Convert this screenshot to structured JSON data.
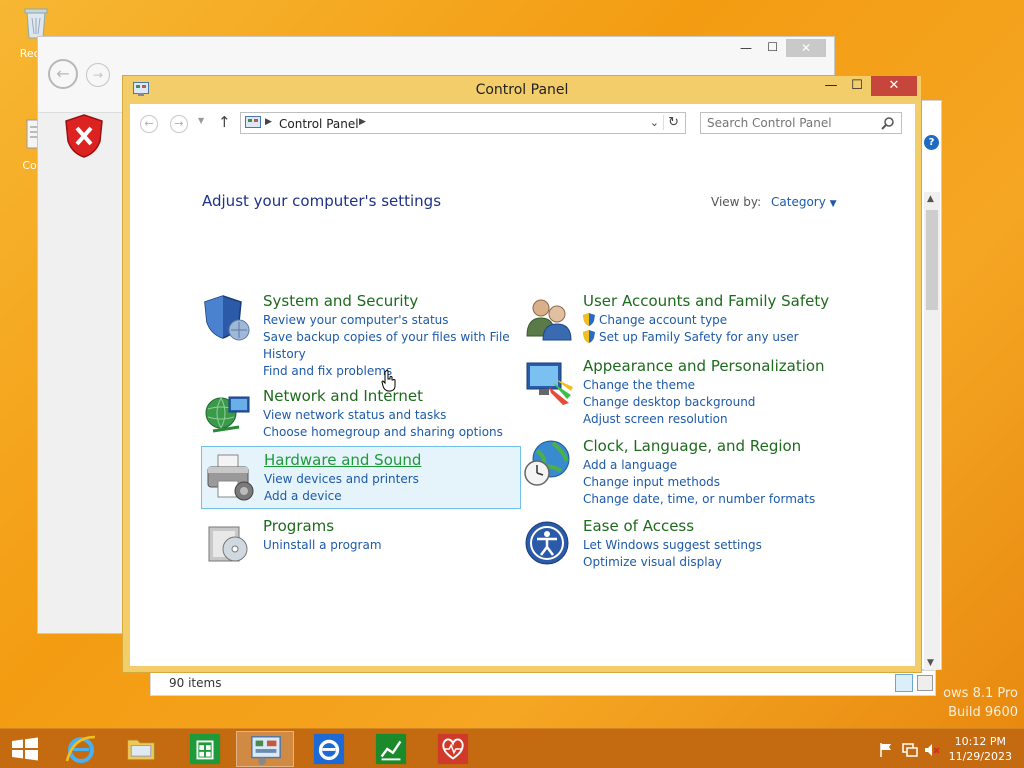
{
  "desktop": {
    "icons": [
      {
        "label": "Recyc"
      },
      {
        "label": "Colla"
      }
    ],
    "watermark": [
      "ows 8.1 Pro",
      "Build 9600"
    ]
  },
  "window": {
    "title": "Control Panel",
    "buttons": {
      "minimize": "—",
      "maximize": "☐",
      "close": "✕"
    }
  },
  "navigation": {
    "breadcrumb": "Control Panel",
    "search_placeholder": "Search Control Panel"
  },
  "main": {
    "heading": "Adjust your computer's settings",
    "view_by_label": "View by:",
    "view_by_value": "Category"
  },
  "categories": [
    {
      "title": "System and Security",
      "links": [
        "Review your computer's status",
        "Save backup copies of your files with File",
        "History",
        "Find and fix problems"
      ]
    },
    {
      "title": "Network and Internet",
      "links": [
        "View network status and tasks",
        "Choose homegroup and sharing options"
      ]
    },
    {
      "title": "Hardware and Sound",
      "links": [
        "View devices and printers",
        "Add a device"
      ]
    },
    {
      "title": "Programs",
      "links": [
        "Uninstall a program"
      ]
    },
    {
      "title": "User Accounts and Family Safety",
      "links": [
        "Change account type",
        "Set up Family Safety for any user"
      ]
    },
    {
      "title": "Appearance and Personalization",
      "links": [
        "Change the theme",
        "Change desktop background",
        "Adjust screen resolution"
      ]
    },
    {
      "title": "Clock, Language, and Region",
      "links": [
        "Add a language",
        "Change input methods",
        "Change date, time, or number formats"
      ]
    },
    {
      "title": "Ease of Access",
      "links": [
        "Let Windows suggest settings",
        "Optimize visual display"
      ]
    }
  ],
  "status": {
    "items_count": "90 items"
  },
  "taskbar": {
    "time": "10:12 PM",
    "date": "11/29/2023"
  },
  "colors": {
    "accent": "#f2cd6a",
    "link": "#1e5aa8",
    "category_title": "#1e6a1e",
    "taskbar": "#c46a10"
  }
}
